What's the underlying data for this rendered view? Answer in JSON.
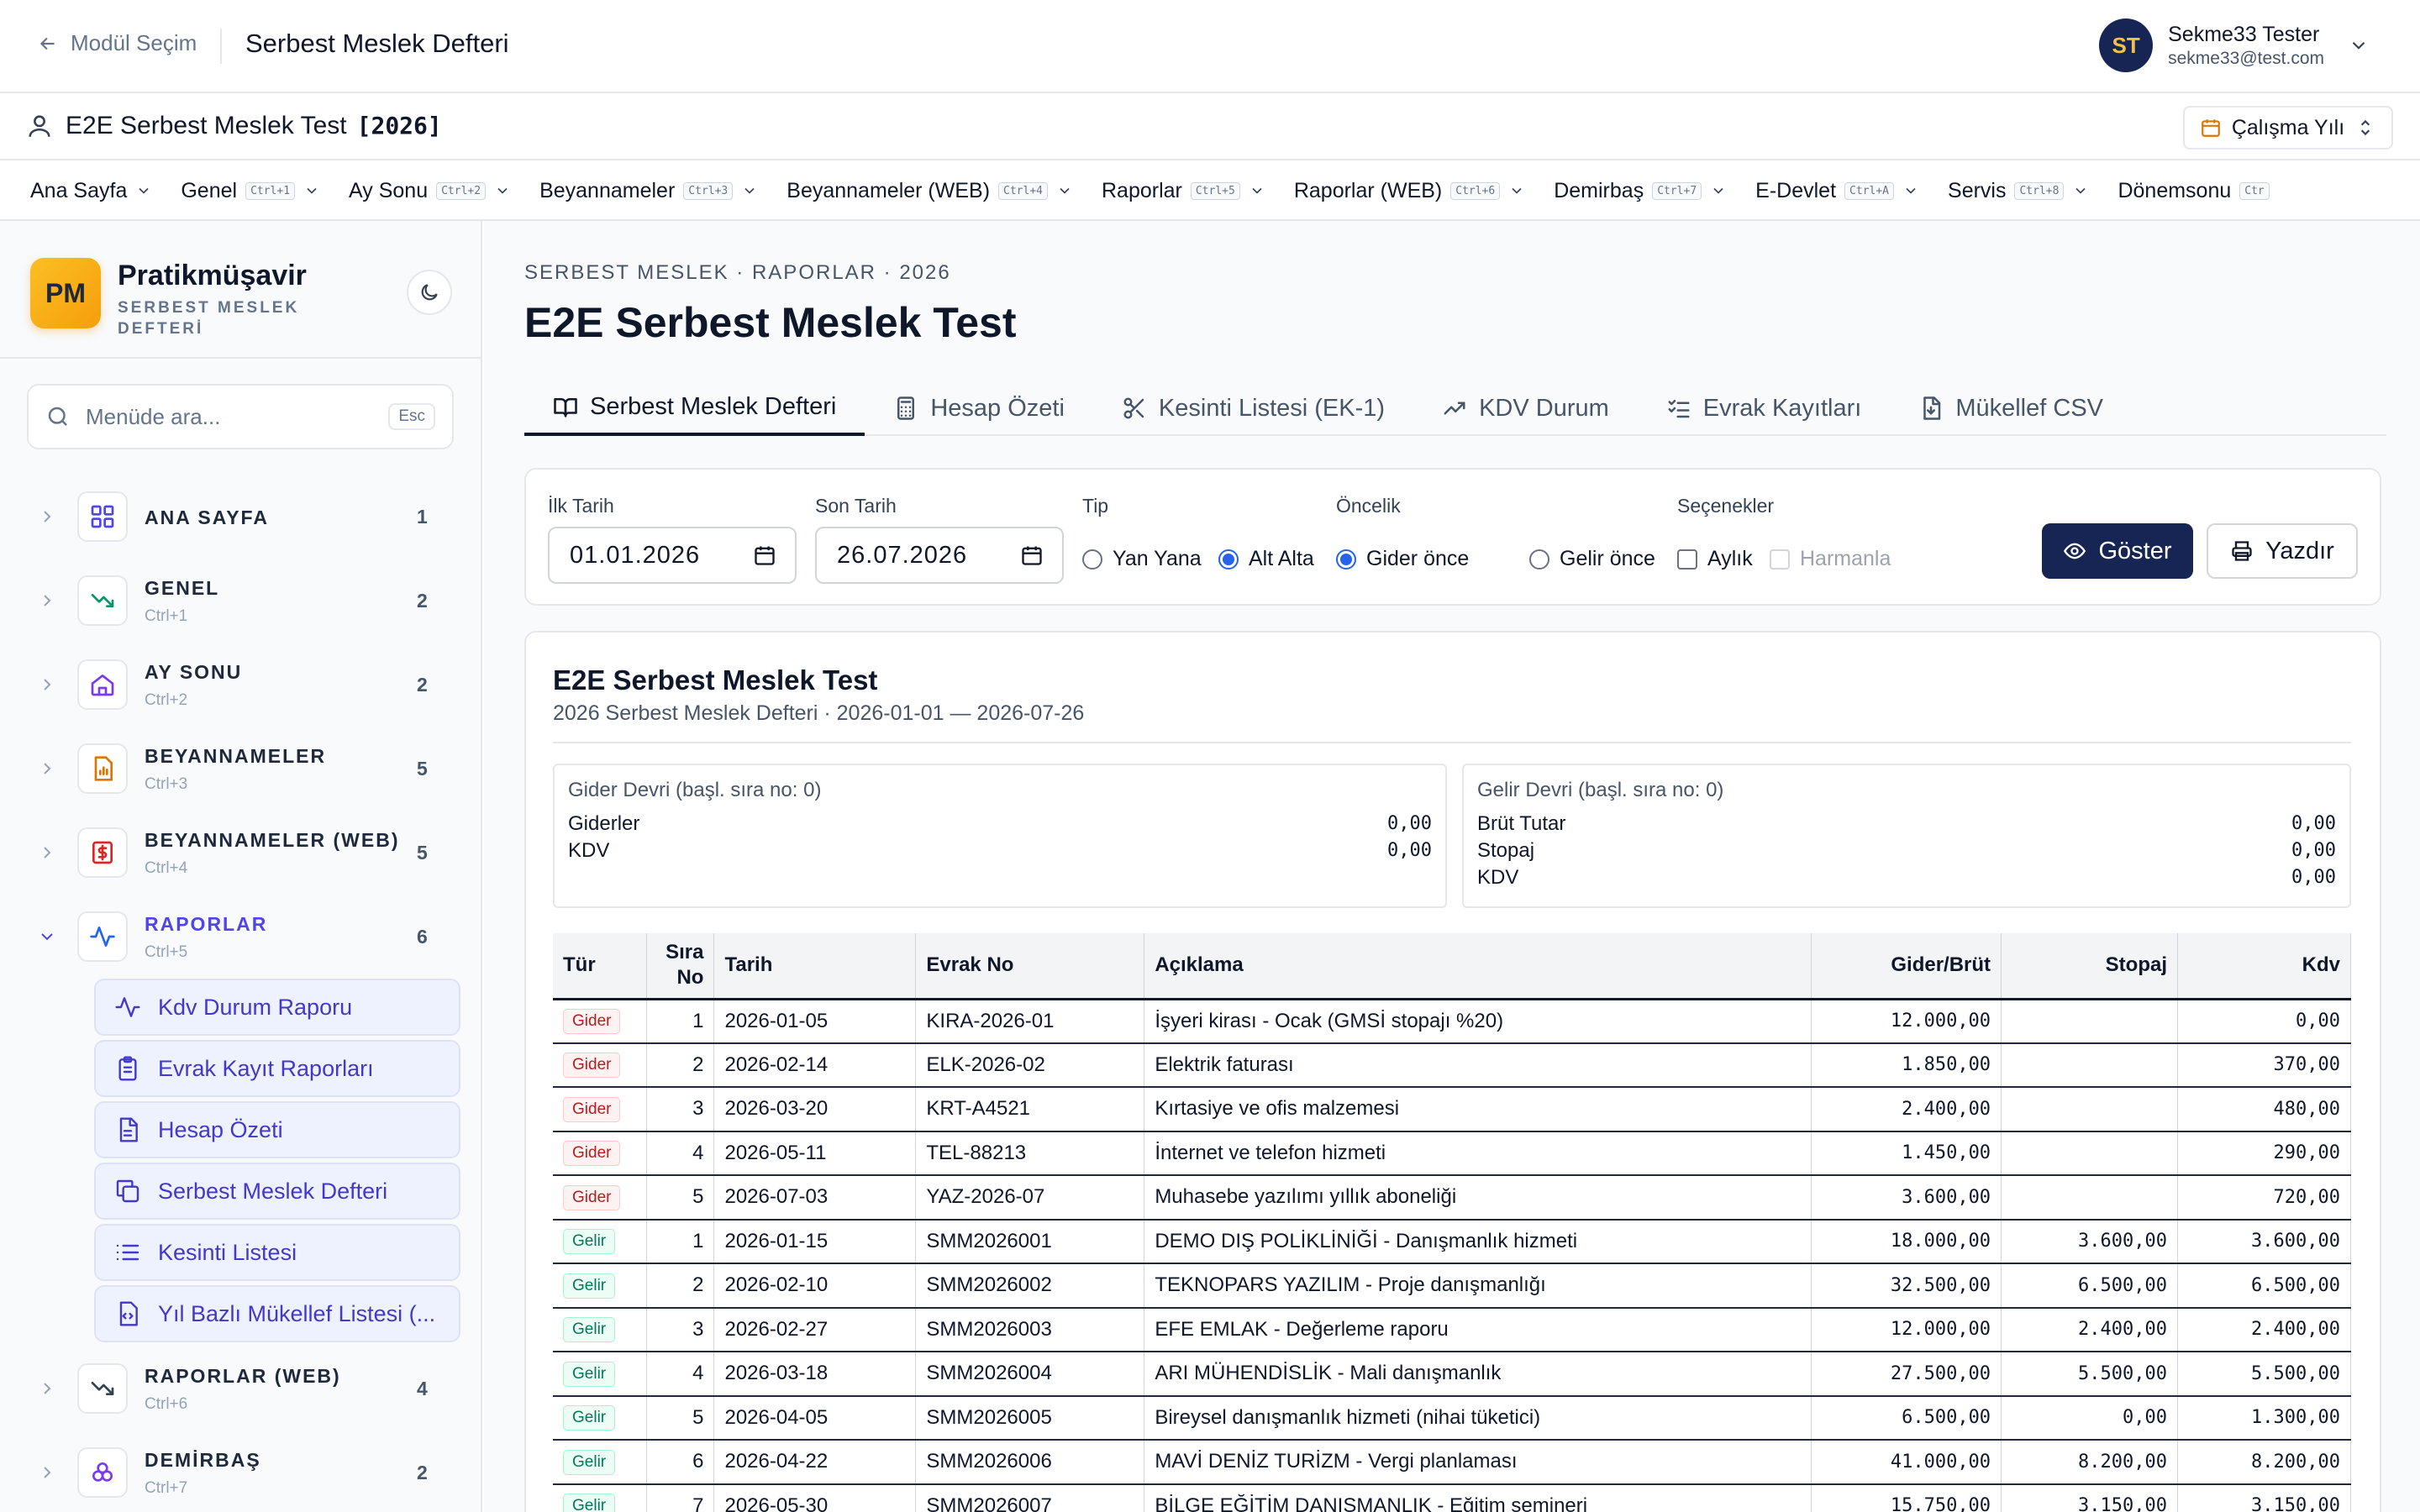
{
  "topbar": {
    "back_label": "Modül Seçim",
    "title": "Serbest Meslek Defteri",
    "user": {
      "initials": "ST",
      "name": "Sekme33 Tester",
      "email": "sekme33@test.com"
    }
  },
  "context": {
    "title": "E2E Serbest Meslek Test",
    "year": "[2026]",
    "year_button": "Çalışma Yılı"
  },
  "menubar": [
    {
      "label": "Ana Sayfa",
      "kbd": ""
    },
    {
      "label": "Genel",
      "kbd": "Ctrl+1"
    },
    {
      "label": "Ay Sonu",
      "kbd": "Ctrl+2"
    },
    {
      "label": "Beyannameler",
      "kbd": "Ctrl+3"
    },
    {
      "label": "Beyannameler (WEB)",
      "kbd": "Ctrl+4"
    },
    {
      "label": "Raporlar",
      "kbd": "Ctrl+5"
    },
    {
      "label": "Raporlar (WEB)",
      "kbd": "Ctrl+6"
    },
    {
      "label": "Demirbaş",
      "kbd": "Ctrl+7"
    },
    {
      "label": "E-Devlet",
      "kbd": "Ctrl+A"
    },
    {
      "label": "Servis",
      "kbd": "Ctrl+8"
    },
    {
      "label": "Dönemsonu",
      "kbd": "Ctr"
    }
  ],
  "sidebar": {
    "brand": {
      "logo": "PM",
      "name": "Pratikmüşavir",
      "subtitle": "SERBEST MESLEK DEFTERİ"
    },
    "search": {
      "placeholder": "Menüde ara...",
      "shortcut": "Esc"
    },
    "items": [
      {
        "label": "ANA SAYFA",
        "kbd": "",
        "count": "1",
        "icon": "grid-icon",
        "color": "#4f46e5"
      },
      {
        "label": "GENEL",
        "kbd": "Ctrl+1",
        "count": "2",
        "icon": "trend-down-icon",
        "color": "#059669"
      },
      {
        "label": "AY SONU",
        "kbd": "Ctrl+2",
        "count": "2",
        "icon": "home-icon",
        "color": "#7c3aed"
      },
      {
        "label": "BEYANNAMELER",
        "kbd": "Ctrl+3",
        "count": "5",
        "icon": "report-icon",
        "color": "#d97706"
      },
      {
        "label": "BEYANNAMELER (WEB)",
        "kbd": "Ctrl+4",
        "count": "5",
        "icon": "dollar-doc-icon",
        "color": "#dc2626"
      },
      {
        "label": "RAPORLAR",
        "kbd": "Ctrl+5",
        "count": "6",
        "icon": "activity-icon",
        "color": "#2563eb"
      },
      {
        "label": "RAPORLAR (WEB)",
        "kbd": "Ctrl+6",
        "count": "4",
        "icon": "trend-down-icon",
        "color": "#334155"
      },
      {
        "label": "DEMİRBAŞ",
        "kbd": "Ctrl+7",
        "count": "2",
        "icon": "boxes-icon",
        "color": "#7c3aed"
      }
    ],
    "sub_items": [
      {
        "label": "Kdv Durum Raporu",
        "icon": "activity-icon"
      },
      {
        "label": "Evrak Kayıt Raporları",
        "icon": "clipboard-icon"
      },
      {
        "label": "Hesap Özeti",
        "icon": "document-icon"
      },
      {
        "label": "Serbest Meslek Defteri",
        "icon": "copy-icon"
      },
      {
        "label": "Kesinti Listesi",
        "icon": "list-icon"
      },
      {
        "label": "Yıl Bazlı Mükellef Listesi (...",
        "icon": "file-code-icon"
      }
    ]
  },
  "main": {
    "breadcrumb": "SERBEST MESLEK · RAPORLAR · 2026",
    "title": "E2E Serbest Meslek Test",
    "tabs": [
      {
        "label": "Serbest Meslek Defteri",
        "icon": "book-icon"
      },
      {
        "label": "Hesap Özeti",
        "icon": "calculator-icon"
      },
      {
        "label": "Kesinti Listesi (EK-1)",
        "icon": "scissors-icon"
      },
      {
        "label": "KDV Durum",
        "icon": "trend-up-icon"
      },
      {
        "label": "Evrak Kayıtları",
        "icon": "checklist-icon"
      },
      {
        "label": "Mükellef CSV",
        "icon": "file-download-icon"
      }
    ],
    "filters": {
      "start_label": "İlk Tarih",
      "start_value": "01.01.2026",
      "end_label": "Son Tarih",
      "end_value": "26.07.2026",
      "tip_label": "Tip",
      "tip_options": [
        "Yan Yana",
        "Alt Alta"
      ],
      "tip_selected": "Alt Alta",
      "priority_label": "Öncelik",
      "priority_options": [
        "Gider önce",
        "Gelir önce"
      ],
      "priority_selected": "Gider önce",
      "options_label": "Seçenekler",
      "opt_monthly": "Aylık",
      "opt_merge": "Harmanla",
      "show_button": "Göster",
      "print_button": "Yazdır"
    },
    "report": {
      "title": "E2E Serbest Meslek Test",
      "subtitle": "2026 Serbest Meslek Defteri · 2026-01-01 — 2026-07-26",
      "gider_devir": {
        "heading": "Gider Devri (başl. sıra no: 0)",
        "rows": [
          {
            "label": "Giderler",
            "value": "0,00"
          },
          {
            "label": "KDV",
            "value": "0,00"
          }
        ]
      },
      "gelir_devir": {
        "heading": "Gelir Devri (başl. sıra no: 0)",
        "rows": [
          {
            "label": "Brüt Tutar",
            "value": "0,00"
          },
          {
            "label": "Stopaj",
            "value": "0,00"
          },
          {
            "label": "KDV",
            "value": "0,00"
          }
        ]
      },
      "columns": [
        "Tür",
        "Sıra No",
        "Tarih",
        "Evrak No",
        "Açıklama",
        "Gider/Brüt",
        "Stopaj",
        "Kdv"
      ],
      "rows": [
        {
          "tur": "Gider",
          "sira": "1",
          "tarih": "2026-01-05",
          "evrak": "KIRA-2026-01",
          "aciklama": "İşyeri kirası - Ocak (GMSİ stopajı %20)",
          "brut": "12.000,00",
          "stopaj": "",
          "kdv": "0,00"
        },
        {
          "tur": "Gider",
          "sira": "2",
          "tarih": "2026-02-14",
          "evrak": "ELK-2026-02",
          "aciklama": "Elektrik faturası",
          "brut": "1.850,00",
          "stopaj": "",
          "kdv": "370,00"
        },
        {
          "tur": "Gider",
          "sira": "3",
          "tarih": "2026-03-20",
          "evrak": "KRT-A4521",
          "aciklama": "Kırtasiye ve ofis malzemesi",
          "brut": "2.400,00",
          "stopaj": "",
          "kdv": "480,00"
        },
        {
          "tur": "Gider",
          "sira": "4",
          "tarih": "2026-05-11",
          "evrak": "TEL-88213",
          "aciklama": "İnternet ve telefon hizmeti",
          "brut": "1.450,00",
          "stopaj": "",
          "kdv": "290,00"
        },
        {
          "tur": "Gider",
          "sira": "5",
          "tarih": "2026-07-03",
          "evrak": "YAZ-2026-07",
          "aciklama": "Muhasebe yazılımı yıllık aboneliği",
          "brut": "3.600,00",
          "stopaj": "",
          "kdv": "720,00"
        },
        {
          "tur": "Gelir",
          "sira": "1",
          "tarih": "2026-01-15",
          "evrak": "SMM2026001",
          "aciklama": "DEMO DIŞ POLİKLİNİĞİ - Danışmanlık hizmeti",
          "brut": "18.000,00",
          "stopaj": "3.600,00",
          "kdv": "3.600,00"
        },
        {
          "tur": "Gelir",
          "sira": "2",
          "tarih": "2026-02-10",
          "evrak": "SMM2026002",
          "aciklama": "TEKNOPARS YAZILIM - Proje danışmanlığı",
          "brut": "32.500,00",
          "stopaj": "6.500,00",
          "kdv": "6.500,00"
        },
        {
          "tur": "Gelir",
          "sira": "3",
          "tarih": "2026-02-27",
          "evrak": "SMM2026003",
          "aciklama": "EFE EMLAK - Değerleme raporu",
          "brut": "12.000,00",
          "stopaj": "2.400,00",
          "kdv": "2.400,00"
        },
        {
          "tur": "Gelir",
          "sira": "4",
          "tarih": "2026-03-18",
          "evrak": "SMM2026004",
          "aciklama": "ARI MÜHENDİSLİK - Mali danışmanlık",
          "brut": "27.500,00",
          "stopaj": "5.500,00",
          "kdv": "5.500,00"
        },
        {
          "tur": "Gelir",
          "sira": "5",
          "tarih": "2026-04-05",
          "evrak": "SMM2026005",
          "aciklama": "Bireysel danışmanlık hizmeti (nihai tüketici)",
          "brut": "6.500,00",
          "stopaj": "0,00",
          "kdv": "1.300,00"
        },
        {
          "tur": "Gelir",
          "sira": "6",
          "tarih": "2026-04-22",
          "evrak": "SMM2026006",
          "aciklama": "MAVİ DENİZ TURİZM - Vergi planlaması",
          "brut": "41.000,00",
          "stopaj": "8.200,00",
          "kdv": "8.200,00"
        },
        {
          "tur": "Gelir",
          "sira": "7",
          "tarih": "2026-05-30",
          "evrak": "SMM2026007",
          "aciklama": "BİLGE EĞİTİM DANIŞMANLIK - Eğitim semineri",
          "brut": "15.750,00",
          "stopaj": "3.150,00",
          "kdv": "3.150,00"
        }
      ]
    }
  }
}
